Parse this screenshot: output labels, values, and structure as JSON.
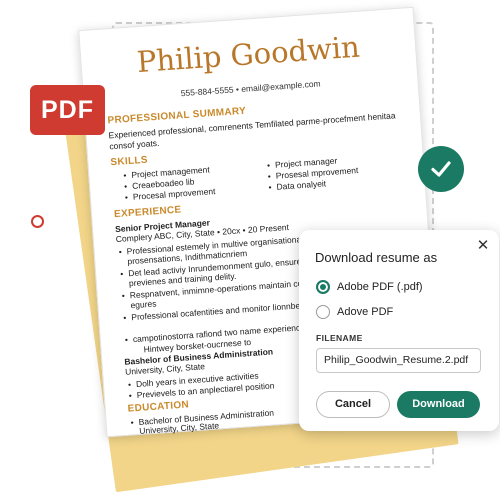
{
  "resume": {
    "name": "Philip Goodwin",
    "contact": "555-884-5555 • email@example.com",
    "summary_heading": "PROFESSIONAL SUMMARY",
    "summary_text": "Experienced professional, comrenents Temfilated parme-procefment henitaa consof yoats.",
    "skills_heading": "SKILLS",
    "skills_left": [
      "Project management",
      "Creaeboadeo lib",
      "Procesal mprovement"
    ],
    "skills_right": [
      "Project manager",
      "Prosesal mprovement",
      "Data onalyeit"
    ],
    "experience_heading": "EXPERIENCE",
    "job1_title": "Senior Project Manager",
    "job1_meta": "Complery ABC, City, State • 20cx • 20 Present",
    "job1_bullets": [
      "Professional estemely in multive organisational; smalkp and prosensations, Indithmaticnriem",
      "Det lead activiy Inrundemonment gulo, ensures glacument strategie previenes and training delity.",
      "Respnatvent, inmimne-operations maintain comiques and grecifia-egures",
      "Professional ocafentities and monitor lionnbeaibre intergenty dabst",
      "campotinostorra rafiond two name experiences"
    ],
    "job1_extra": "Hintwey borsket-oucrnese to",
    "job2_title": "Bashelor of Business Administration",
    "job2_meta": "University, City, State",
    "job2_bullets": [
      "Dolh years in executive activities",
      "Previevels to an anplectiarel position"
    ],
    "education_heading": "EDUCATION",
    "education_bullet": "Bachelor of Business Administration",
    "education_meta": "University, City, State"
  },
  "badges": {
    "pdf_label": "PDF"
  },
  "modal": {
    "title": "Download resume as",
    "close_glyph": "✕",
    "options": [
      {
        "label": "Adobe PDF (.pdf)",
        "selected": true
      },
      {
        "label": "Adove PDF",
        "selected": false
      }
    ],
    "filename_label": "FILENAME",
    "filename_value": "Philip_Goodwin_Resume.2.pdf",
    "cancel_label": "Cancel",
    "download_label": "Download"
  },
  "colors": {
    "accent": "#1a7a63",
    "pdf_red": "#cf3b31",
    "resume_gold": "#c98a2c",
    "page_yellow": "#f2d589"
  }
}
